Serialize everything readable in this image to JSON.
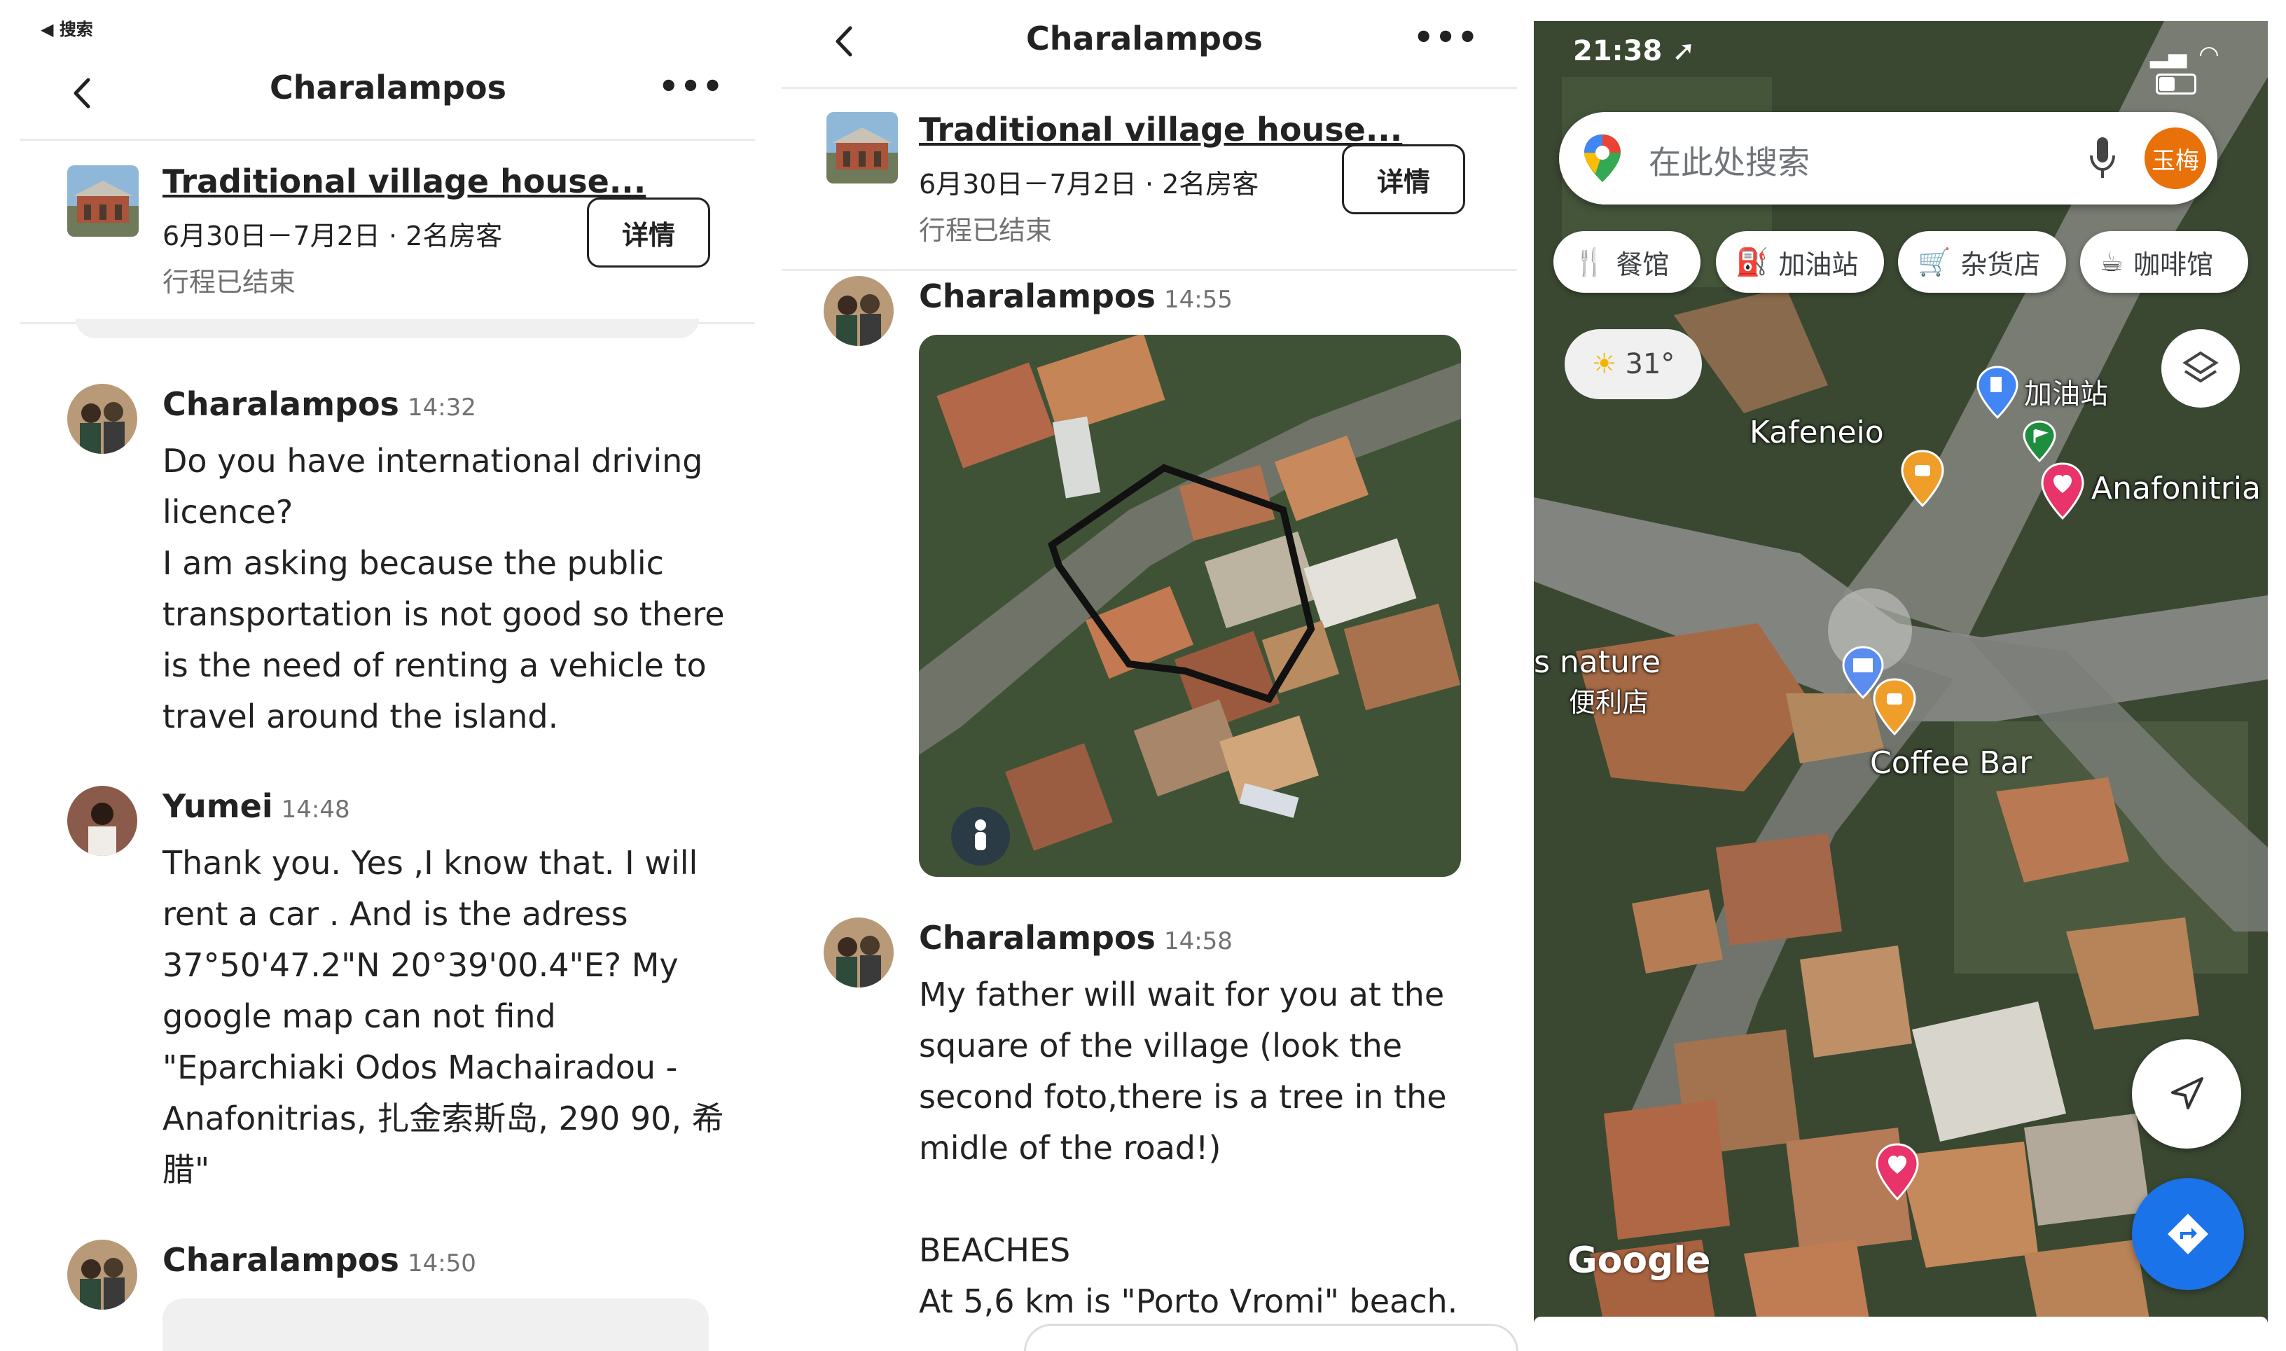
{
  "colors": {
    "text_primary": "#222222",
    "text_secondary": "#717171",
    "divider": "#ebebeb",
    "map_blue": "#1a73e8",
    "avatar_orange": "#e8710a"
  },
  "panel1": {
    "back_link": "◀ 搜索",
    "header_title": "Charalampos",
    "more_icon": "ellipsis-icon",
    "listing": {
      "title": "Traditional village house...",
      "dates": "6月30日－7月2日 · 2名房客",
      "status": "行程已结束",
      "details_label": "详情"
    },
    "messages": [
      {
        "name": "Charalampos",
        "time": "14:32",
        "text": "Do you have international driving\nlicence?\nI am asking because the public\ntransportation is not good so there\nis the need of renting a vehicle to\ntravel around the island."
      },
      {
        "name": "Yumei",
        "time": "14:48",
        "text": "Thank you. Yes ,I know that.  I will\nrent a car . And is the adress\n37°50'47.2\"N 20°39'00.4\"E?   My\ngoogle map can not find\n\"Eparchiaki Odos Machairadou -\nAnafonitrias, 扎金索斯岛, 290 90, 希\n腊\""
      },
      {
        "name": "Charalampos",
        "time": "14:50",
        "text": ""
      }
    ]
  },
  "panel2": {
    "header_title": "Charalampos",
    "more_icon": "ellipsis-icon",
    "listing": {
      "title": "Traditional village house...",
      "dates": "6月30日－7月2日 · 2名房客",
      "status": "行程已结束",
      "details_label": "详情"
    },
    "messages": [
      {
        "name": "Charalampos",
        "time": "14:55",
        "text": ""
      },
      {
        "name": "Charalampos",
        "time": "14:58",
        "text": "My father will wait for you at the\nsquare of the village (look the\nsecond foto,there is a tree in the\nmidle of the road!)\n\nBEACHES\nAt 5,6 km is \"Porto Vromi\" beach."
      }
    ]
  },
  "panel3": {
    "clock": "21:38",
    "search_placeholder": "在此处搜索",
    "avatar_text": "玉梅",
    "chips": [
      {
        "label": "餐馆",
        "icon": "fork-knife-icon"
      },
      {
        "label": "加油站",
        "icon": "gas-station-icon"
      },
      {
        "label": "杂货店",
        "icon": "cart-icon"
      },
      {
        "label": "咖啡馆",
        "icon": "coffee-icon"
      }
    ],
    "weather": "31°",
    "places": {
      "kafeneio": "Kafeneio",
      "gas": "加油站",
      "anafonitria": "Anafonitria",
      "nature": "s nature",
      "store": "便利店",
      "coffee_bar": "Coffee Bar"
    },
    "google_logo": "Google"
  }
}
